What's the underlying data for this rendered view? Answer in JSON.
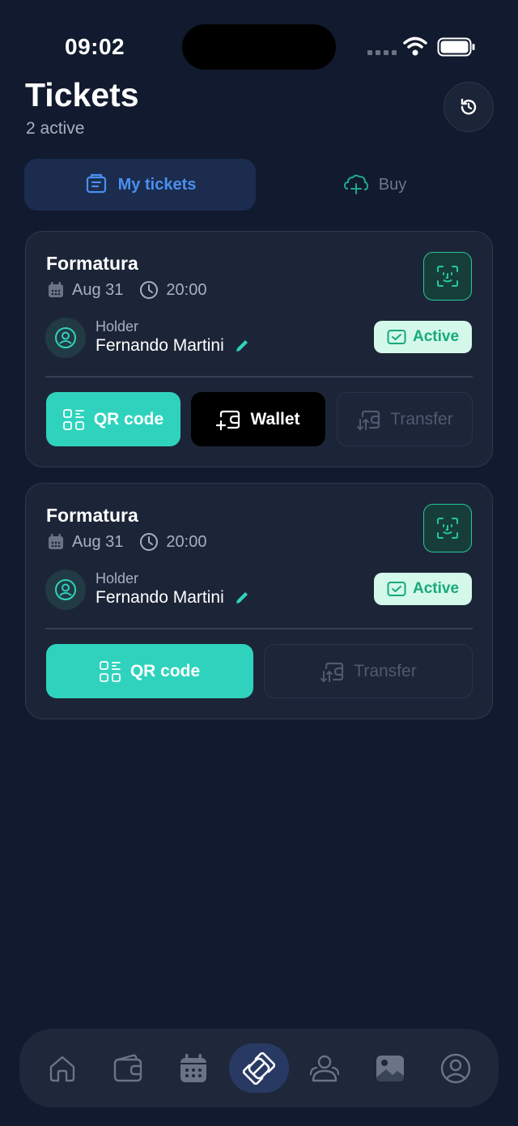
{
  "status_bar": {
    "time": "09:02"
  },
  "header": {
    "title": "Tickets",
    "subtitle": "2 active",
    "refresh_icon": "refresh-icon"
  },
  "tabs": [
    {
      "label": "My tickets",
      "icon": "ticket-icon",
      "active": true
    },
    {
      "label": "Buy",
      "icon": "cart-plus-icon",
      "active": false
    }
  ],
  "tickets": [
    {
      "event": "Formatura",
      "date": "Aug 31",
      "time": "20:00",
      "holder_label": "Holder",
      "holder_name": "Fernando Martini",
      "status": "Active",
      "buttons": {
        "qr": "QR code",
        "wallet": "Wallet",
        "transfer": "Transfer"
      }
    },
    {
      "event": "Formatura",
      "date": "Aug 31",
      "time": "20:00",
      "holder_label": "Holder",
      "holder_name": "Fernando Martini",
      "status": "Active",
      "buttons": {
        "qr": "QR code",
        "transfer": "Transfer"
      }
    }
  ],
  "bottom_nav": [
    {
      "icon": "home-icon",
      "active": false
    },
    {
      "icon": "wallet-icon",
      "active": false
    },
    {
      "icon": "calendar-icon",
      "active": false
    },
    {
      "icon": "ticket-link-icon",
      "active": true
    },
    {
      "icon": "people-icon",
      "active": false
    },
    {
      "icon": "gallery-icon",
      "active": false
    },
    {
      "icon": "profile-icon",
      "active": false
    }
  ],
  "colors": {
    "accent": "#2fd3bd",
    "tab_active": "#4a8ff0",
    "background": "#111a2e",
    "card": "#1c2537"
  }
}
